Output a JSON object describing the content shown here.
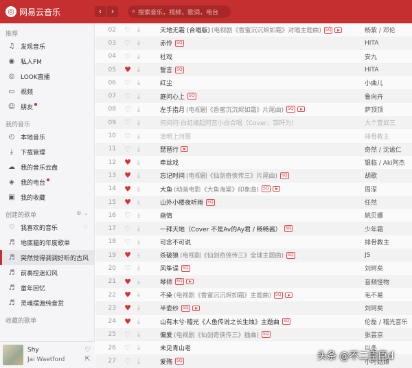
{
  "topbar": {
    "app_name": "网易云音乐",
    "logo_glyph": "◎",
    "back_glyph": "‹",
    "forward_glyph": "›",
    "search_placeholder": "搜索音乐，视频，歌词，电台",
    "brand_color": "#c62f2f"
  },
  "sidebar": {
    "recommend_title": "推荐",
    "recommend": [
      {
        "label": "发现音乐",
        "icon": "music-note-icon",
        "glyph": "♫"
      },
      {
        "label": "私人FM",
        "icon": "radio-icon",
        "glyph": "◉"
      },
      {
        "label": "LOOK直播",
        "icon": "live-icon",
        "glyph": "◎"
      },
      {
        "label": "视频",
        "icon": "video-icon",
        "glyph": "▭"
      },
      {
        "label": "朋友",
        "icon": "friends-icon",
        "glyph": "☺",
        "dot": true
      }
    ],
    "mymusic_title": "我的音乐",
    "mymusic": [
      {
        "label": "本地音乐",
        "icon": "disc-icon",
        "glyph": "◴"
      },
      {
        "label": "下载管理",
        "icon": "download-icon",
        "glyph": "⤓"
      },
      {
        "label": "我的音乐云盘",
        "icon": "cloud-icon",
        "glyph": "☁"
      },
      {
        "label": "我的电台",
        "icon": "podcast-icon",
        "glyph": "◈",
        "dot": true
      },
      {
        "label": "我的收藏",
        "icon": "collection-icon",
        "glyph": "▣"
      }
    ],
    "created_title": "创建的歌单",
    "created_ctrl": "⊕ ⌄",
    "created": [
      {
        "label": "我喜欢的音乐",
        "icon": "heart-outline-icon",
        "glyph": "♡",
        "extra": "♢"
      },
      {
        "label": "地底猫的年度歌单",
        "icon": "playlist-icon",
        "glyph": "♬"
      },
      {
        "label": "突然觉得调调好听的古风",
        "icon": "playlist-icon",
        "glyph": "♬",
        "active": true
      },
      {
        "label": "前奏控迷幻风",
        "icon": "playlist-icon",
        "glyph": "♬"
      },
      {
        "label": "童年回忆",
        "icon": "playlist-icon",
        "glyph": "♬"
      },
      {
        "label": "灵魂摆渡纯音赏",
        "icon": "playlist-icon",
        "glyph": "♬"
      }
    ],
    "collected_title": "收藏的歌单"
  },
  "now_playing": {
    "title": "Shy",
    "artist": "Jai Waetford",
    "like_glyph": "♡",
    "share_glyph": "⇱"
  },
  "glyphs": {
    "heart_on": "♥",
    "heart_off": "♡",
    "download": "⤓"
  },
  "songs": [
    {
      "num": "02",
      "title": "天地无霜 (合唱版)",
      "alias": "(电视剧《香蜜沉沉烬如霜》对唱主题曲)",
      "sq": true,
      "mv": true,
      "liked": false,
      "artist": "杨紫 / 邓伦"
    },
    {
      "num": "03",
      "title": "赤伶",
      "alias": "",
      "sq": true,
      "mv": false,
      "liked": false,
      "artist": "HITA"
    },
    {
      "num": "04",
      "title": "社戏",
      "alias": "",
      "sq": false,
      "mv": false,
      "liked": false,
      "artist": "安九"
    },
    {
      "num": "05",
      "title": "誓言",
      "alias": "",
      "sq": true,
      "mv": false,
      "liked": true,
      "artist": "HITA"
    },
    {
      "num": "06",
      "title": "红尘",
      "alias": "",
      "sq": false,
      "mv": false,
      "liked": false,
      "artist": "小曲儿"
    },
    {
      "num": "07",
      "title": "庭问心上",
      "alias": "",
      "sq": true,
      "mv": false,
      "liked": false,
      "artist": "鲁向卉"
    },
    {
      "num": "08",
      "title": "左手指月",
      "alias": "(电视剧《香蜜沉沉烬如霜》片尾曲)",
      "sq": true,
      "mv": true,
      "liked": false,
      "artist": "萨顶顶"
    },
    {
      "num": "09",
      "title": "何间问·白虹缘起阿宫小白合唱（Cover：郭旰为）",
      "alias": "",
      "sq": false,
      "mv": false,
      "liked": false,
      "artist": "大个萱奴三",
      "dim": true
    },
    {
      "num": "10",
      "title": "清明上河图",
      "alias": "",
      "sq": false,
      "mv": false,
      "liked": false,
      "artist": "排骨教主",
      "dim": true
    },
    {
      "num": "11",
      "title": "琵琶行",
      "alias": "",
      "sq": false,
      "mv": true,
      "liked": false,
      "artist": "奇然 / 沈谧仁"
    },
    {
      "num": "12",
      "title": "牵丝戏",
      "alias": "",
      "sq": false,
      "mv": false,
      "liked": true,
      "artist": "银临 / Aki阿杰"
    },
    {
      "num": "13",
      "title": "忘记时间",
      "alias": "(电视剧《仙剑奇侠传三》片尾曲)",
      "sq": true,
      "mv": false,
      "liked": true,
      "artist": "胡歌"
    },
    {
      "num": "14",
      "title": "大鱼",
      "alias": "(动画电影《大鱼海棠》印象曲)",
      "sq": true,
      "mv": true,
      "liked": true,
      "artist": "周深"
    },
    {
      "num": "15",
      "title": "山外小楼夜听雨",
      "alias": "",
      "sq": true,
      "mv": false,
      "liked": true,
      "artist": "任然"
    },
    {
      "num": "16",
      "title": "画情",
      "alias": "",
      "sq": false,
      "mv": false,
      "liked": false,
      "artist": "姚贝娜"
    },
    {
      "num": "17",
      "title": "一拜天地（Cover 不是Av的Ay君 / 畅畅酱）",
      "alias": "",
      "sq": true,
      "mv": false,
      "liked": false,
      "artist": "少年霜"
    },
    {
      "num": "18",
      "title": "可念不可说",
      "alias": "",
      "sq": false,
      "mv": false,
      "liked": false,
      "artist": "排骨教主"
    },
    {
      "num": "19",
      "title": "杀破狼",
      "alias": "(电视剧《仙剑奇侠传三》全球主题曲)",
      "sq": true,
      "mv": false,
      "liked": true,
      "artist": "JS"
    },
    {
      "num": "20",
      "title": "风筝误",
      "alias": "",
      "sq": true,
      "mv": false,
      "liked": false,
      "artist": "刘珂矣"
    },
    {
      "num": "21",
      "title": "琴师",
      "alias": "",
      "sq": true,
      "mv": true,
      "liked": true,
      "artist": "音频怪物"
    },
    {
      "num": "22",
      "title": "不染",
      "alias": "(电视剧《香蜜沉沉烬如霜》主题曲)",
      "sq": true,
      "mv": true,
      "liked": true,
      "artist": "毛不易"
    },
    {
      "num": "23",
      "title": "半壶纱",
      "alias": "",
      "sq": true,
      "mv": true,
      "liked": true,
      "artist": "刘珂矣"
    },
    {
      "num": "24",
      "title": "山有木兮·稽光《人鱼传说之长生烛》主题曲",
      "alias": "",
      "sq": true,
      "mv": false,
      "liked": true,
      "artist": "伦磊 / 稽光音乐"
    },
    {
      "num": "25",
      "title": "偏爱",
      "alias": "(电视剧《仙剑奇侠传三》插曲)",
      "sq": true,
      "mv": false,
      "liked": false,
      "artist": "张芸京"
    },
    {
      "num": "26",
      "title": "未见青山老",
      "alias": "",
      "sq": false,
      "mv": false,
      "liked": false,
      "artist": "以冬"
    },
    {
      "num": "27",
      "title": "爱殇",
      "alias": "",
      "sq": true,
      "mv": false,
      "liked": false,
      "artist": "小时姑娘"
    }
  ],
  "watermark": "头条 @不二臣臣d"
}
